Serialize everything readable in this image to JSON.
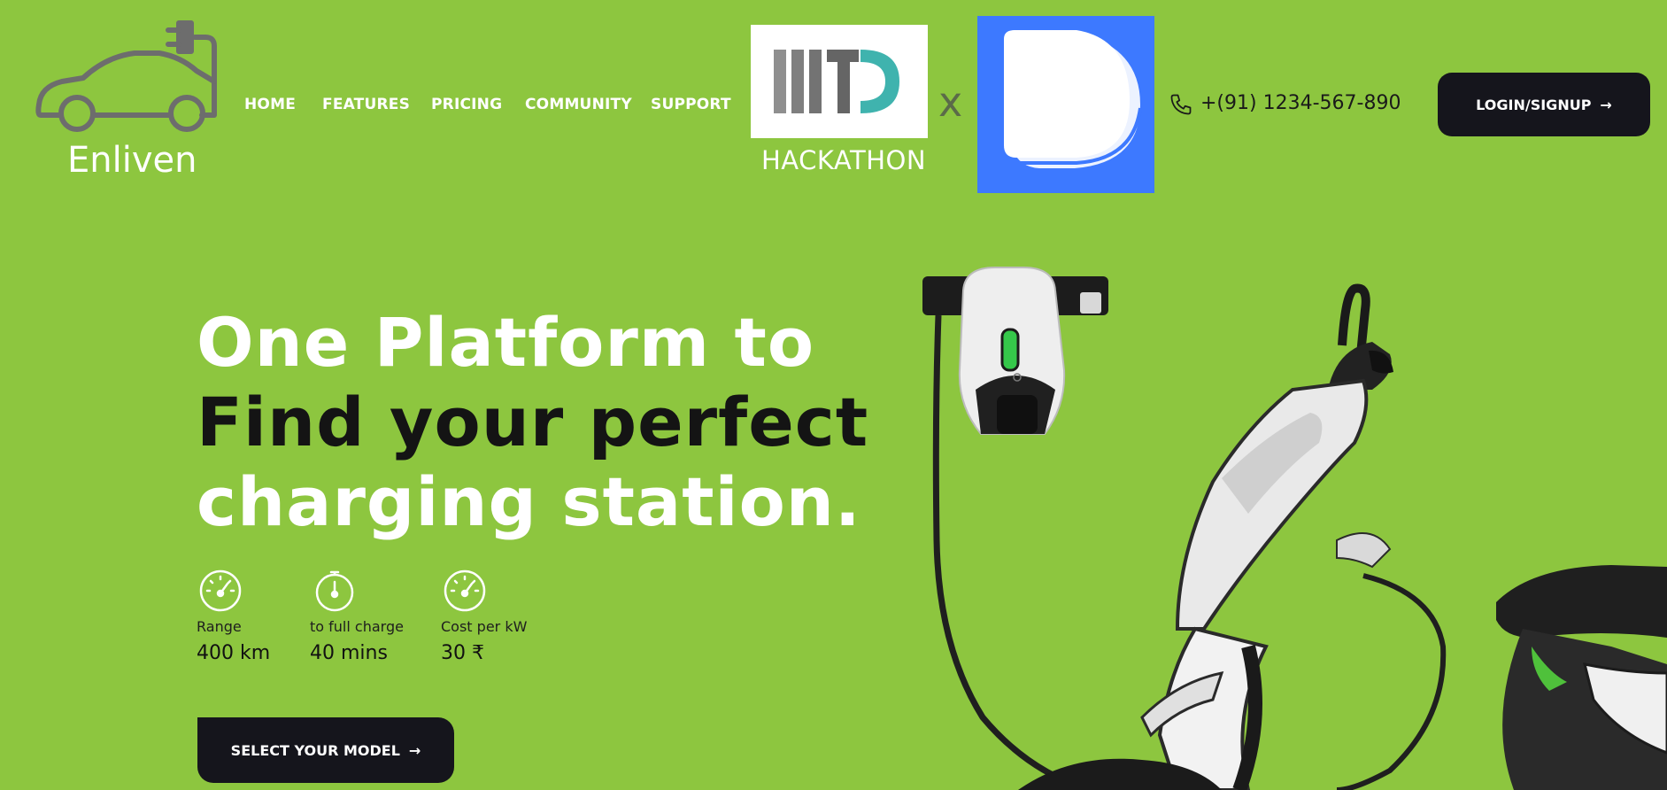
{
  "brand": {
    "name": "Enliven",
    "logo_icon": "electric-car-plug-icon"
  },
  "nav": {
    "items": [
      {
        "label": "HOME"
      },
      {
        "label": "FEATURES"
      },
      {
        "label": "PRICING"
      },
      {
        "label": "COMMUNITY"
      },
      {
        "label": "SUPPORT"
      }
    ]
  },
  "partners": {
    "hackathon_label": "HACKATHON",
    "separator": "x",
    "iiitd_logo_icon": "iiitd-logo",
    "partner_logo_icon": "d-logo"
  },
  "contact": {
    "phone": "+(91) 1234-567-890",
    "phone_icon": "phone-icon"
  },
  "login": {
    "label": "LOGIN/SIGNUP",
    "arrow": "→"
  },
  "hero": {
    "line1": "One Platform to",
    "line2": "Find your perfect",
    "line3": "charging station."
  },
  "stats": [
    {
      "icon": "speedometer-icon",
      "label": "Range",
      "value": "400 km"
    },
    {
      "icon": "stopwatch-icon",
      "label": "to full charge",
      "value": "40 mins"
    },
    {
      "icon": "speedometer-icon",
      "label": "Cost per kW",
      "value": "30 ₹"
    }
  ],
  "cta": {
    "label": "SELECT YOUR MODEL",
    "arrow": "→"
  },
  "colors": {
    "background": "#8dc63f",
    "button": "#15151c",
    "partner_blue": "#3d79ff",
    "iiitd_teal": "#3fb3ae"
  }
}
